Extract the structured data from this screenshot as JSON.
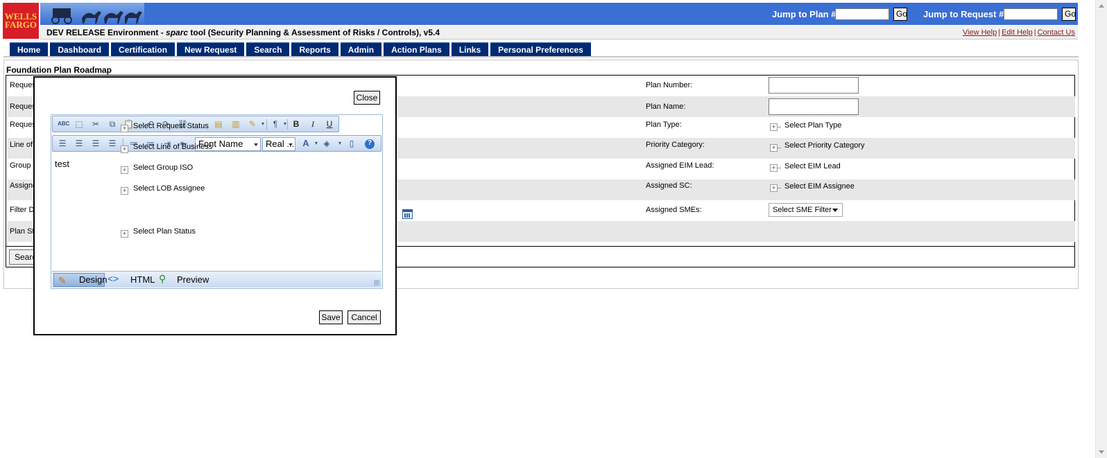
{
  "header": {
    "logo_line1": "WELLS",
    "logo_line2": "FARGO",
    "jump_plan_label": "Jump to Plan #:",
    "jump_request_label": "Jump to Request #:",
    "go_label": "Go",
    "env_prefix": "DEV RELEASE Environment - ",
    "env_app": "sparc",
    "env_suffix": " tool (Security Planning & Assessment of Risks / Controls), v5.4",
    "help_links": [
      "View Help",
      "Edit Help",
      "Contact Us"
    ],
    "brand_color": "#3a6fd3"
  },
  "nav": {
    "tabs": [
      "Home",
      "Dashboard",
      "Certification",
      "New Request",
      "Search",
      "Reports",
      "Admin",
      "Action Plans",
      "Links",
      "Personal Preferences"
    ],
    "tab_color": "#002a72"
  },
  "form": {
    "section_title": "Foundation Plan Roadmap",
    "left_labels": [
      "Reques",
      "Reques",
      "Reques",
      "Line of",
      "Group I",
      "Assigne",
      "Filter Da",
      "Plan Sta"
    ],
    "right_labels": {
      "plan_number": "Plan Number:",
      "plan_name": "Plan Name:",
      "plan_type": "Plan Type:",
      "priority_category": "Priority Category:",
      "assigned_eim_lead": "Assigned EIM Lead:",
      "assigned_sc": "Assigned SC:",
      "assigned_smes": "Assigned SMEs:"
    },
    "right_selects": {
      "plan_type": "Select Plan Type",
      "priority_category": "Select Priority Category",
      "eim_lead": "Select EIM Lead",
      "eim_assignee": "Select EIM Assignee",
      "sme_filter": "Select SME Filter"
    },
    "search_label": "Search"
  },
  "modal": {
    "close_label": "Close",
    "save_label": "Save",
    "cancel_label": "Cancel",
    "editor_text": "test",
    "font_name": "Font Name",
    "font_size": "Real ...",
    "design_label": "Design",
    "html_label": "HTML",
    "preview_label": "Preview",
    "bleed_options": {
      "request_status": "Select Request Status",
      "line_of_business": "Select Line of Business",
      "group_iso": "Select Group ISO",
      "lob_assignee": "Select LOB Assignee",
      "plan_status": "Select Plan Status"
    }
  }
}
